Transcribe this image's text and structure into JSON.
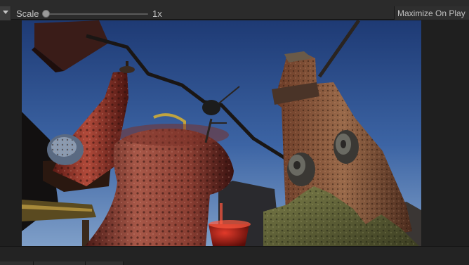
{
  "toolbar": {
    "scale_label": "Scale",
    "scale_value": "1x",
    "maximize_label": "Maximize On Play"
  },
  "viewport": {
    "scene": "game-view",
    "sky_colors": [
      "#1e3a74",
      "#3c64a4",
      "#7f9fc8"
    ]
  },
  "icons": {
    "dropdown": "chevron-down-icon"
  }
}
